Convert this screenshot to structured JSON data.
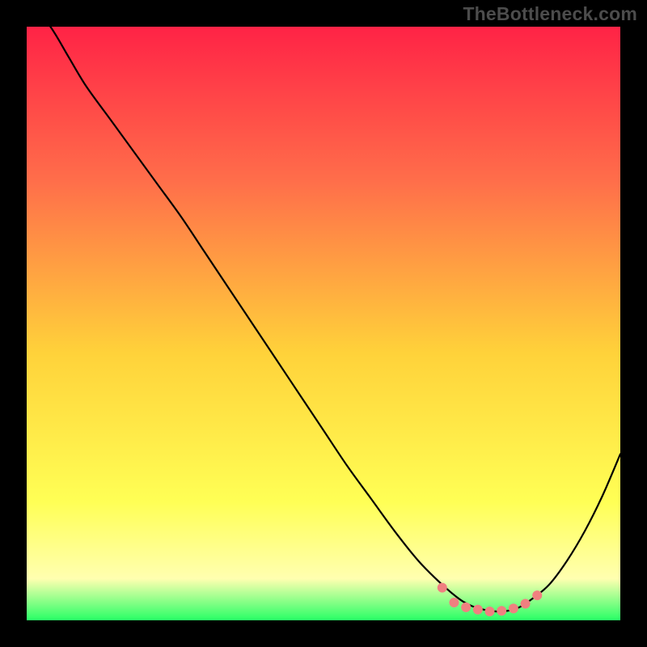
{
  "watermark": "TheBottleneck.com",
  "colors": {
    "bg": "#000000",
    "gradient_top": "#ff2346",
    "gradient_mid1": "#ff6e4a",
    "gradient_mid2": "#ffd23a",
    "gradient_mid3": "#ffff55",
    "gradient_mid4": "#ffffb0",
    "gradient_bottom": "#28ff66",
    "curve": "#000000",
    "marker_fill": "#f08080",
    "marker_stroke": "#f08080"
  },
  "chart_data": {
    "type": "line",
    "title": "",
    "xlabel": "",
    "ylabel": "",
    "xlim": [
      0,
      100
    ],
    "ylim": [
      0,
      100
    ],
    "grid": false,
    "legend": false,
    "x": [
      0,
      4,
      7,
      10,
      14,
      18,
      22,
      26,
      30,
      34,
      38,
      42,
      46,
      50,
      54,
      58,
      62,
      66,
      70,
      73,
      75,
      77,
      79,
      81,
      83,
      85,
      88,
      91,
      94,
      97,
      100
    ],
    "values": [
      105,
      100,
      95,
      90,
      84.5,
      79,
      73.5,
      68,
      62,
      56,
      50,
      44,
      38,
      32,
      26,
      20.5,
      15,
      10,
      6,
      3.5,
      2.4,
      1.8,
      1.5,
      1.6,
      2.2,
      3.5,
      6,
      10,
      15,
      21,
      28
    ],
    "markers": {
      "x": [
        70,
        72,
        74,
        76,
        78,
        80,
        82,
        84,
        86
      ],
      "y": [
        5.5,
        3.0,
        2.2,
        1.8,
        1.5,
        1.6,
        2.0,
        2.8,
        4.2
      ]
    }
  }
}
